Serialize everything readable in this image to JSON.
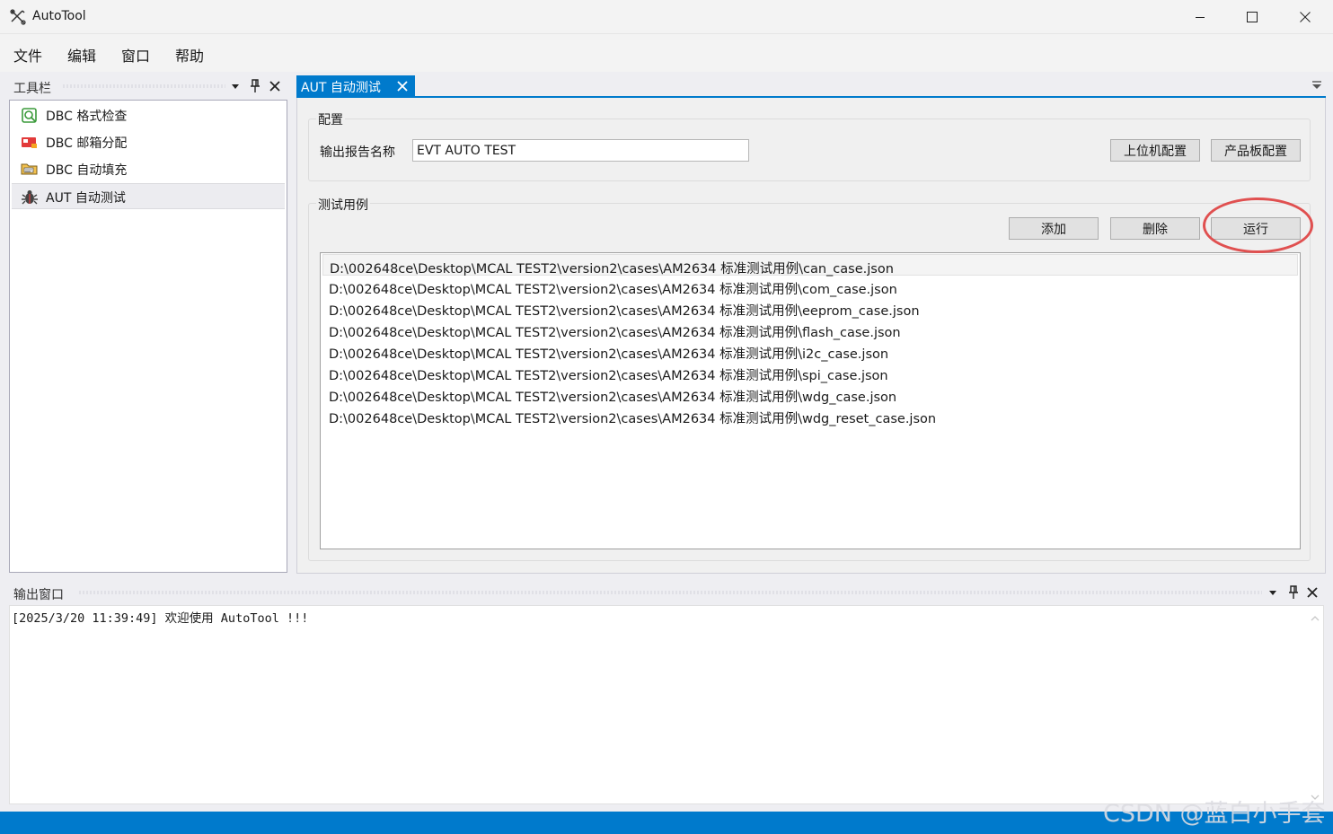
{
  "window": {
    "title": "AutoTool"
  },
  "menu": {
    "items": [
      "文件",
      "编辑",
      "窗口",
      "帮助"
    ]
  },
  "toolbox": {
    "title": "工具栏",
    "items": [
      {
        "label": "DBC 格式检查",
        "icon": "dbc-check-icon"
      },
      {
        "label": "DBC 邮箱分配",
        "icon": "dbc-mailbox-icon"
      },
      {
        "label": "DBC 自动填充",
        "icon": "dbc-autofill-icon"
      },
      {
        "label": "AUT 自动测试",
        "icon": "bug-icon",
        "selected": true
      }
    ]
  },
  "document": {
    "tab_label": "AUT 自动测试",
    "config": {
      "group_title": "配置",
      "output_name_label": "输出报告名称",
      "output_name_value": "EVT AUTO TEST",
      "host_config_button": "上位机配置",
      "board_config_button": "产品板配置"
    },
    "cases": {
      "group_title": "测试用例",
      "add_button": "添加",
      "delete_button": "删除",
      "run_button": "运行",
      "items": [
        "D:\\002648ce\\Desktop\\MCAL TEST2\\version2\\cases\\AM2634 标准测试用例\\can_case.json",
        "D:\\002648ce\\Desktop\\MCAL TEST2\\version2\\cases\\AM2634 标准测试用例\\com_case.json",
        "D:\\002648ce\\Desktop\\MCAL TEST2\\version2\\cases\\AM2634 标准测试用例\\eeprom_case.json",
        "D:\\002648ce\\Desktop\\MCAL TEST2\\version2\\cases\\AM2634 标准测试用例\\flash_case.json",
        "D:\\002648ce\\Desktop\\MCAL TEST2\\version2\\cases\\AM2634 标准测试用例\\i2c_case.json",
        "D:\\002648ce\\Desktop\\MCAL TEST2\\version2\\cases\\AM2634 标准测试用例\\spi_case.json",
        "D:\\002648ce\\Desktop\\MCAL TEST2\\version2\\cases\\AM2634 标准测试用例\\wdg_case.json",
        "D:\\002648ce\\Desktop\\MCAL TEST2\\version2\\cases\\AM2634 标准测试用例\\wdg_reset_case.json"
      ]
    }
  },
  "output": {
    "title": "输出窗口",
    "log": "[2025/3/20 11:39:49] 欢迎使用 AutoTool !!!"
  },
  "watermark": "CSDN @蓝白小手套",
  "colors": {
    "accent": "#007acc",
    "highlight_circle": "#e05050"
  }
}
